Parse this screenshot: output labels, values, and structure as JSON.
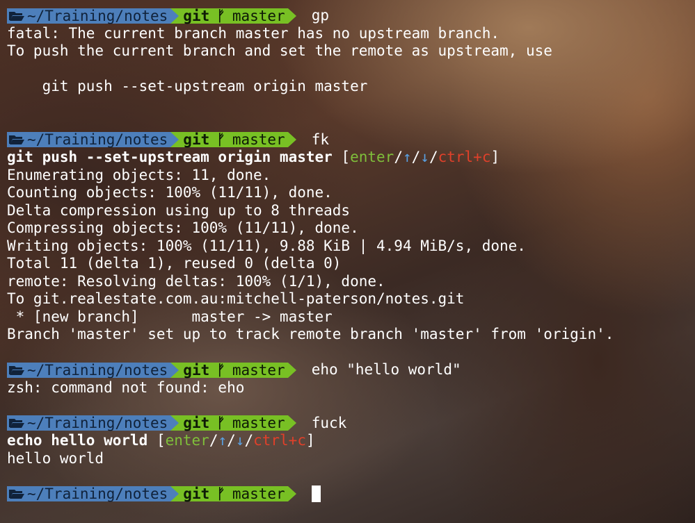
{
  "prompt": {
    "path": "~/Training/notes",
    "git_label": "git",
    "branch_icon": "branch-icon",
    "branch": "master",
    "colors": {
      "path_bg": "#4d7fbb",
      "git_bg": "#78c024"
    }
  },
  "block1": {
    "command": "gp",
    "output": [
      "fatal: The current branch master has no upstream branch.",
      "To push the current branch and set the remote as upstream, use",
      "",
      "    git push --set-upstream origin master"
    ]
  },
  "block2": {
    "command": "fk",
    "suggestion": "git push --set-upstream origin master",
    "hint": {
      "open": "[",
      "enter": "enter",
      "sep1": "/",
      "up": "↑",
      "sep2": "/",
      "down": "↓",
      "sep3": "/",
      "ctrlc": "ctrl+c",
      "close": "]"
    },
    "output": [
      "Enumerating objects: 11, done.",
      "Counting objects: 100% (11/11), done.",
      "Delta compression using up to 8 threads",
      "Compressing objects: 100% (11/11), done.",
      "Writing objects: 100% (11/11), 9.88 KiB | 4.94 MiB/s, done.",
      "Total 11 (delta 1), reused 0 (delta 0)",
      "remote: Resolving deltas: 100% (1/1), done.",
      "To git.realestate.com.au:mitchell-paterson/notes.git",
      " * [new branch]      master -> master",
      "Branch 'master' set up to track remote branch 'master' from 'origin'."
    ]
  },
  "block3": {
    "command": "eho \"hello world\"",
    "output": [
      "zsh: command not found: eho"
    ]
  },
  "block4": {
    "command": "fuck",
    "suggestion": "echo hello world",
    "hint": {
      "open": "[",
      "enter": "enter",
      "sep1": "/",
      "up": "↑",
      "sep2": "/",
      "down": "↓",
      "sep3": "/",
      "ctrlc": "ctrl+c",
      "close": "]"
    },
    "output": [
      "hello world"
    ]
  },
  "block5": {
    "command": ""
  }
}
